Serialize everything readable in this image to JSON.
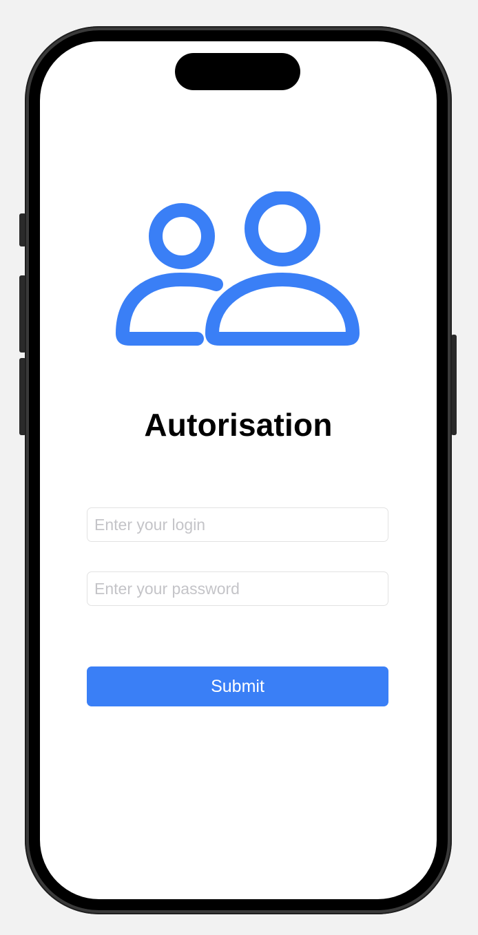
{
  "app": {
    "title": "Autorisation",
    "header_icon": "two-users-icon"
  },
  "form": {
    "login_placeholder": "Enter your login",
    "login_value": "",
    "password_placeholder": "Enter your password",
    "password_value": "",
    "submit_label": "Submit"
  },
  "colors": {
    "accent": "#3a7ff6",
    "background": "#ffffff",
    "title_text": "#000000",
    "placeholder_text": "#c4c4c8"
  }
}
